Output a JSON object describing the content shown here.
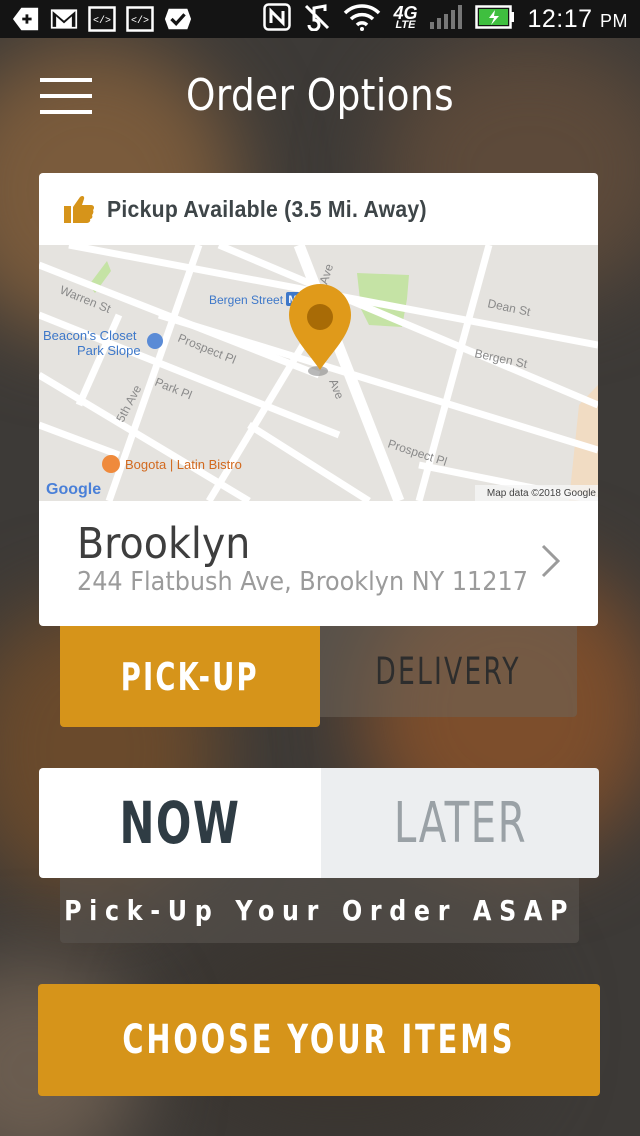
{
  "status_bar": {
    "time": "12:17",
    "ampm": "PM",
    "network": "4G LTE",
    "icons": [
      "add-icon",
      "gmail-icon",
      "code-icon",
      "code-icon",
      "check-icon",
      "nfc-icon",
      "mute-icon",
      "wifi-icon",
      "signal-icon",
      "battery-charging-icon"
    ]
  },
  "header": {
    "title": "Order Options",
    "menu_icon": "hamburger-menu-icon"
  },
  "location_card": {
    "availability": "Pickup Available (3.5 Mi. Away)",
    "availability_icon": "thumbs-up-icon",
    "map": {
      "streets": [
        "Warren St",
        "Bergen Street",
        "Dean St",
        "Bergen St",
        "Prospect Pl",
        "Park Pl",
        "5th Ave",
        "Prospect Pl",
        "Ave",
        "Ave"
      ],
      "places": [
        "Beacon's Closet",
        "Park Slope",
        "Bogota | Latin Bistro"
      ],
      "attribution": "Map data ©2018 Google",
      "logo": "Google"
    },
    "name": "Brooklyn",
    "address": "244 Flatbush Ave, Brooklyn NY 11217"
  },
  "order_type": {
    "pickup": "PICK-UP",
    "delivery": "DELIVERY",
    "selected": "pickup"
  },
  "timing": {
    "now": "NOW",
    "later": "LATER",
    "selected": "now",
    "note": "Pick-Up Your Order ASAP"
  },
  "cta": "CHOOSE YOUR ITEMS",
  "colors": {
    "accent": "#d6941a",
    "dark_text": "#2f3c44",
    "pin": "#e09a1a"
  }
}
